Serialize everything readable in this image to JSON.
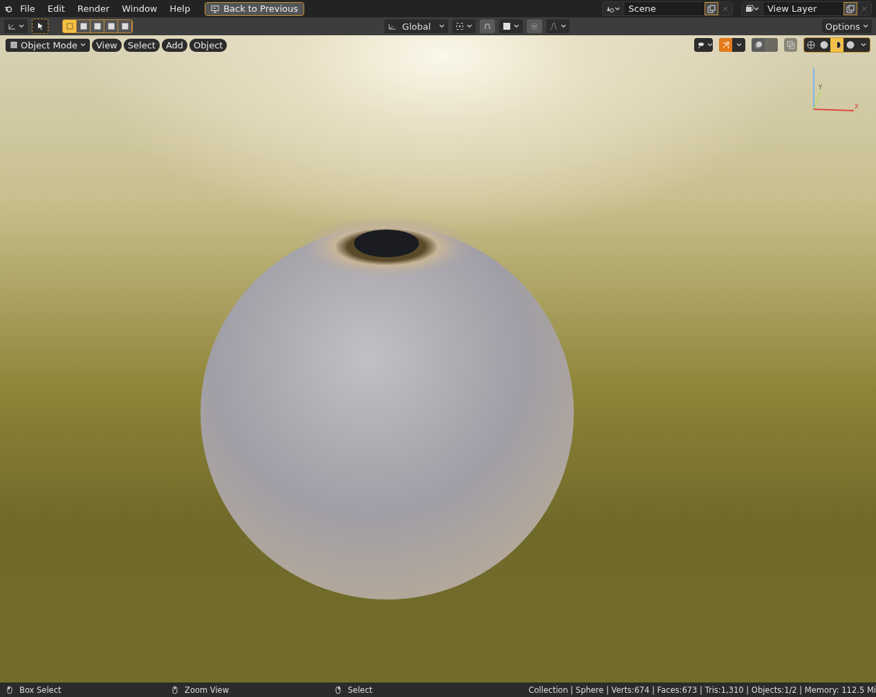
{
  "menu": [
    "File",
    "Edit",
    "Render",
    "Window",
    "Help"
  ],
  "back_button": "Back to Previous",
  "scene": {
    "name": "Scene"
  },
  "view_layer": {
    "name": "View Layer"
  },
  "toolbar": {
    "select_modes": [
      {
        "selected": true
      },
      {
        "selected": false
      },
      {
        "selected": false
      },
      {
        "selected": false
      },
      {
        "selected": false
      }
    ],
    "orientation": "Global",
    "snap": false,
    "proportional": false,
    "options": "Options"
  },
  "viewport_header": {
    "mode": "Object Mode",
    "menus": [
      "View",
      "Select",
      "Add",
      "Object"
    ],
    "gizmos_on": true,
    "overlays_on": false,
    "xray": false,
    "shading": [
      {
        "selected": false
      },
      {
        "selected": false
      },
      {
        "selected": true
      },
      {
        "selected": false
      }
    ]
  },
  "gizmo": {
    "x_label": "X",
    "y_label": "Y"
  },
  "status_bar": {
    "hints": [
      "Box Select",
      "Zoom View",
      "Select"
    ],
    "stats": "Collection | Sphere | Verts:674 | Faces:673 | Tris:1,310 | Objects:1/2 | Memory: 112.5 Mi"
  }
}
